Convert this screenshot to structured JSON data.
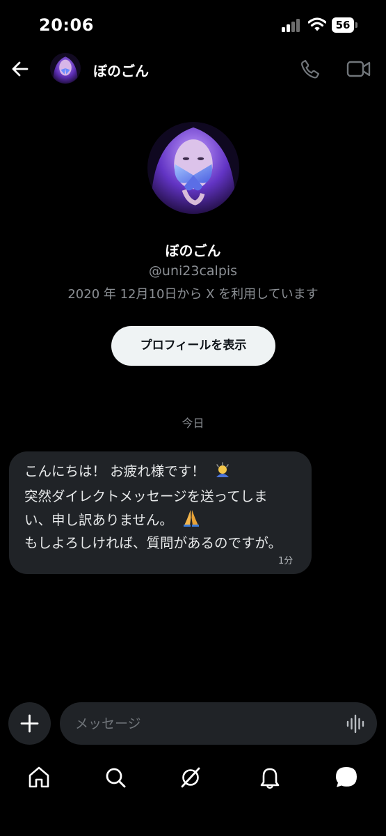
{
  "status_bar": {
    "time": "20:06",
    "battery": "56"
  },
  "header": {
    "name": "ぼのごん"
  },
  "profile": {
    "name": "ぼのごん",
    "handle": "@uni23calpis",
    "joined": "2020 年 12月10日から X を利用しています",
    "view_profile_label": "プロフィールを表示"
  },
  "chat": {
    "date_label": "今日",
    "message": {
      "lines": [
        "こんにちは！ お疲れ様です！",
        "突然ダイレクトメッセージを送ってしま",
        "い、申し訳ありません。",
        "もしよろしければ、質問があるのですが。"
      ],
      "time": "1分"
    }
  },
  "composer": {
    "placeholder": "メッセージ"
  },
  "tab_bar": {
    "items": [
      "home-icon",
      "search-icon",
      "grok-icon",
      "notifications-icon",
      "messages-icon"
    ]
  },
  "colors": {
    "background": "#000000",
    "bubble": "#202327",
    "muted_text": "#8b8f94",
    "button_bg": "#eff3f4",
    "accent_purple": "#7b4fd6"
  }
}
